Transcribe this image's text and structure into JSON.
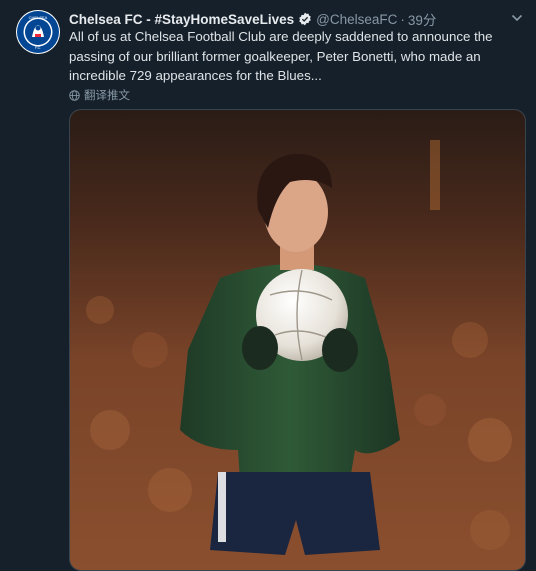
{
  "tweet": {
    "display_name": "Chelsea FC - #StayHomeSaveLives",
    "handle": "@ChelseaFC",
    "separator": "·",
    "time": "39分",
    "text": "All of us at Chelsea Football Club are deeply saddened to announce the passing of our brilliant former goalkeeper, Peter Bonetti, who made an incredible 729 appearances for the Blues...",
    "translate_label": "翻译推文",
    "avatar_text": "CHELSEA FOOTBALL CLUB"
  },
  "icons": {
    "verified": "verified-badge-icon",
    "more": "chevron-down-icon",
    "translate": "globe-icon"
  },
  "colors": {
    "background": "#15202b",
    "verified": "#1da1f2",
    "chelsea_blue": "#034694",
    "muted_text": "#8899a6"
  }
}
